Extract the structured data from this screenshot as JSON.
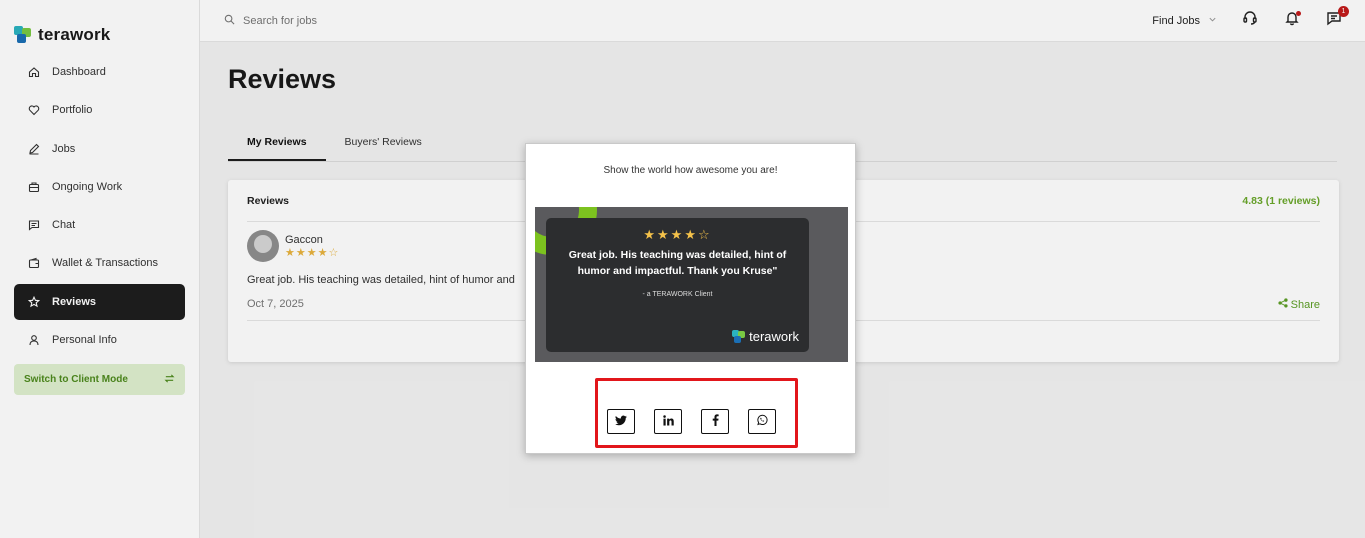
{
  "brand": {
    "name": "terawork"
  },
  "sidebar": {
    "items": [
      {
        "label": "Dashboard",
        "icon": "home-icon"
      },
      {
        "label": "Portfolio",
        "icon": "heart-icon"
      },
      {
        "label": "Jobs",
        "icon": "pencil-icon"
      },
      {
        "label": "Ongoing Work",
        "icon": "briefcase-icon"
      },
      {
        "label": "Chat",
        "icon": "chat-icon"
      },
      {
        "label": "Wallet & Transactions",
        "icon": "wallet-icon"
      },
      {
        "label": "Reviews",
        "icon": "star-icon",
        "active": true
      },
      {
        "label": "Personal Info",
        "icon": "user-icon"
      }
    ],
    "switch_mode": "Switch to Client Mode"
  },
  "topbar": {
    "search_placeholder": "Search for jobs",
    "find_jobs": "Find Jobs",
    "messages_badge": "1"
  },
  "page": {
    "title": "Reviews",
    "tabs": [
      {
        "label": "My Reviews",
        "active": true
      },
      {
        "label": "Buyers' Reviews",
        "active": false
      }
    ]
  },
  "reviews_card": {
    "title": "Reviews",
    "rating_summary": "4.83 (1 reviews)",
    "review": {
      "name": "Gaccon",
      "stars": "★★★★☆",
      "text": "Great job. His teaching was detailed, hint of humor and",
      "date": "Oct 7, 2025"
    },
    "share_label": "Share"
  },
  "modal": {
    "title": "Show the world how awesome you are!",
    "card": {
      "stars": "★★★★☆",
      "quote": "Great job. His teaching was detailed, hint of humor and impactful. Thank you Kruse\"",
      "attribution": "- a TERAWORK Client",
      "brand": "terawork"
    },
    "social": [
      "twitter-icon",
      "linkedin-icon",
      "facebook-icon",
      "whatsapp-icon"
    ]
  },
  "colors": {
    "accent_green": "#6aa72b",
    "highlight_red": "#e2161b",
    "dark": "#1e1e1e"
  }
}
